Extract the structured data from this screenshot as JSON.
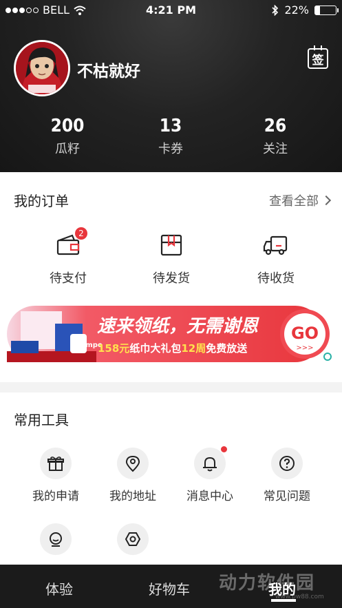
{
  "status_bar": {
    "carrier": "BELL",
    "time": "4:21 PM",
    "battery_text": "22%",
    "battery_level": 0.22,
    "signal_bars": 3
  },
  "profile": {
    "username": "不枯就好",
    "sign_label": "签"
  },
  "stats": [
    {
      "value": "200",
      "label": "瓜籽"
    },
    {
      "value": "13",
      "label": "卡券"
    },
    {
      "value": "26",
      "label": "关注"
    }
  ],
  "orders": {
    "title": "我的订单",
    "see_all": "查看全部",
    "items": [
      {
        "label": "待支付",
        "badge": "2",
        "icon": "wallet-icon"
      },
      {
        "label": "待发货",
        "icon": "package-icon"
      },
      {
        "label": "待收货",
        "icon": "truck-icon"
      }
    ]
  },
  "banner": {
    "headline": "速来领纸，无需谢恩",
    "sub_1": "158元",
    "sub_2": "纸巾大礼包",
    "sub_3": "12周",
    "sub_4": "免费放送",
    "go": "GO",
    "arrows": ">>>",
    "brand": "Tempo",
    "accent_color": "#e8363c"
  },
  "tools": {
    "title": "常用工具",
    "items": [
      {
        "label": "我的申请",
        "icon": "gift-icon"
      },
      {
        "label": "我的地址",
        "icon": "location-icon"
      },
      {
        "label": "消息中心",
        "icon": "bell-icon",
        "unread": true
      },
      {
        "label": "常见问题",
        "icon": "question-icon"
      },
      {
        "label": "",
        "icon": "customer-service-icon"
      },
      {
        "label": "",
        "icon": "settings-icon"
      }
    ]
  },
  "tabbar": {
    "tabs": [
      {
        "label": "体验"
      },
      {
        "label": "好物车"
      },
      {
        "label": "我的",
        "active": true
      }
    ]
  },
  "watermark": {
    "text": "动力软件园",
    "sub": "www.pw88.com"
  }
}
